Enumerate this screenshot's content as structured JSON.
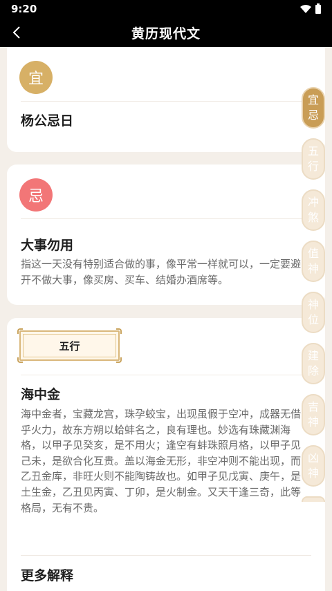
{
  "status": {
    "time": "9:20"
  },
  "nav": {
    "title": "黄历现代文"
  },
  "yi": {
    "badge": "宜",
    "title": "杨公忌日",
    "color": "#d7b066"
  },
  "ji": {
    "badge": "忌",
    "title": "大事勿用",
    "description": "指这一天没有特别适合做的事，像平常一样就可以，一定要避开不做大事，像买房、买车、结婚办酒席等。",
    "color": "#f27677"
  },
  "wuxing": {
    "box_label": "五行",
    "title": "海中金",
    "description": "海中金者，宝藏龙宫，珠孕蛟宝，出现虽假于空冲，成器无借乎火力，故东方朔以蛤蚌名之，良有理也。妙选有珠藏渊海格，以甲子见癸亥，是不用火；逢空有蚌珠照月格，以甲子见己未，是欲合化互贵。盖以海金无形，非空冲则不能出现，而乙丑金库，非旺火则不能陶铸故也。如甲子见戊寅、庚午，是土生金，乙丑见丙寅、丁卯，是火制金。又天干逢三奇，此等格局，无有不贵。",
    "more_title": "更多解释"
  },
  "side_tabs": [
    {
      "label": [
        "宜",
        "忌"
      ],
      "active": true
    },
    {
      "label": [
        "五",
        "行"
      ],
      "active": false
    },
    {
      "label": [
        "冲",
        "煞"
      ],
      "active": false
    },
    {
      "label": [
        "值",
        "神"
      ],
      "active": false
    },
    {
      "label": [
        "神",
        "位"
      ],
      "active": false
    },
    {
      "label": [
        "建",
        "除"
      ],
      "active": false
    },
    {
      "label": [
        "吉",
        "神"
      ],
      "active": false
    },
    {
      "label": [
        "凶",
        "神"
      ],
      "active": false
    }
  ]
}
